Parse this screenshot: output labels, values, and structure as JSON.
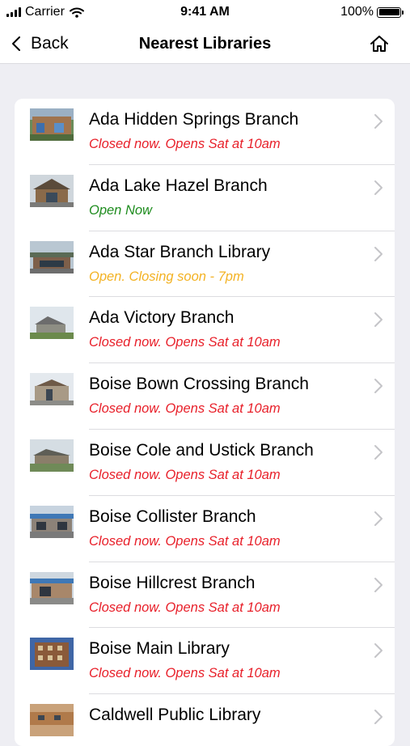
{
  "status_bar": {
    "carrier": "Carrier",
    "time": "9:41 AM",
    "battery": "100%",
    "battery_level": 1.0
  },
  "nav": {
    "back_label": "Back",
    "title": "Nearest Libraries",
    "home_icon": "home-icon"
  },
  "colors": {
    "closed": "#e8202a",
    "open": "#1e8c1e",
    "closing_soon": "#f3b223"
  },
  "libraries": [
    {
      "name": "Ada Hidden Springs Branch",
      "status": "Closed now. Opens Sat at 10am",
      "state": "closed"
    },
    {
      "name": "Ada Lake Hazel Branch",
      "status": "Open Now",
      "state": "open"
    },
    {
      "name": "Ada Star Branch Library",
      "status": "Open. Closing soon - 7pm",
      "state": "closing_soon"
    },
    {
      "name": "Ada Victory Branch",
      "status": "Closed now. Opens Sat at 10am",
      "state": "closed"
    },
    {
      "name": "Boise Bown Crossing Branch",
      "status": "Closed now. Opens Sat at 10am",
      "state": "closed"
    },
    {
      "name": "Boise Cole and Ustick Branch",
      "status": "Closed now. Opens Sat at 10am",
      "state": "closed"
    },
    {
      "name": "Boise Collister Branch",
      "status": "Closed now. Opens Sat at 10am",
      "state": "closed"
    },
    {
      "name": "Boise Hillcrest Branch",
      "status": "Closed now. Opens Sat at 10am",
      "state": "closed"
    },
    {
      "name": "Boise Main Library",
      "status": "Closed now. Opens Sat at 10am",
      "state": "closed"
    },
    {
      "name": "Caldwell Public Library",
      "status": "",
      "state": "closed"
    }
  ]
}
